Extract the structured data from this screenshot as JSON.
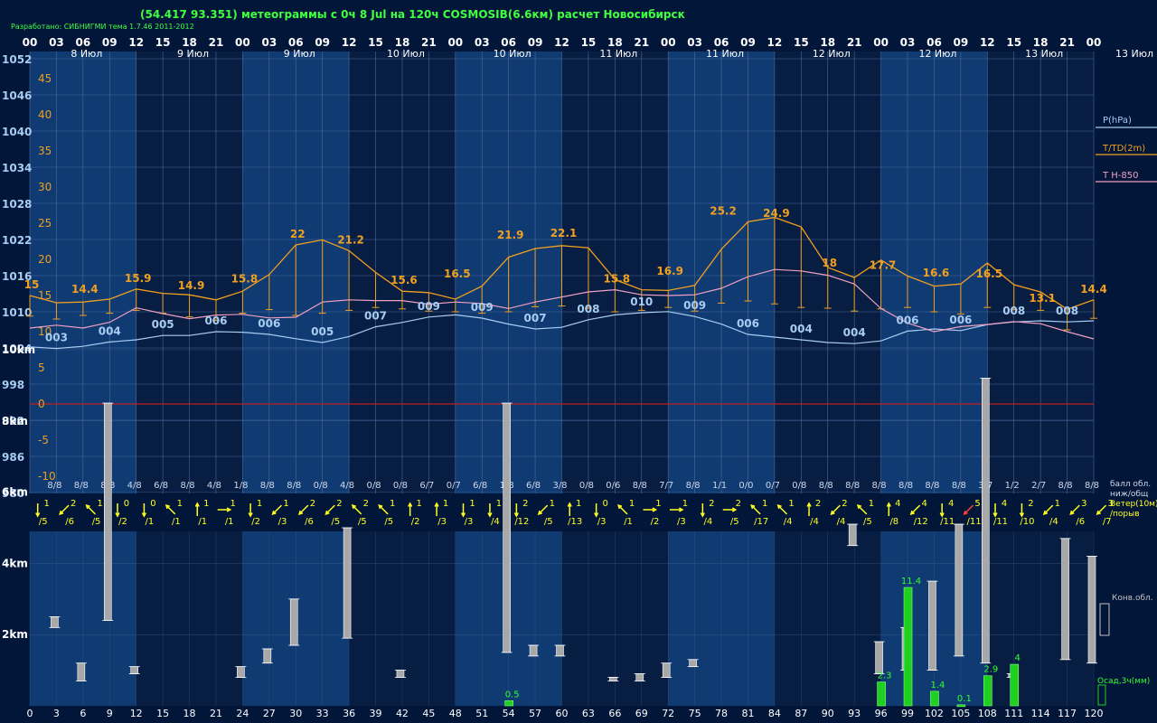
{
  "header": {
    "title": "(54.417 93.351) метеограммы с  0ч 8 Jul на 120ч COSMOSIB(6.6км) расчет Новосибирск",
    "credit": "Разработано: СИБНИГМИ тема 1.7.46 2011-2012"
  },
  "colors": {
    "background": "#02163a",
    "band_light": "#0f3a72",
    "band_dark": "#071d42",
    "grid": "#4d6a99",
    "pressure": "#a9ccf2",
    "temperature": "#f0a020",
    "t850": "#f0a0c0",
    "wind": "#ffff20",
    "wind_strong": "#ff4030",
    "cloud_bar": "#a8a8a8",
    "precip_bar": "#20d020",
    "precip_label": "#30ff30",
    "zero_line": "#c02020"
  },
  "chart_data": {
    "type": "line",
    "hour_ticks": [
      "00",
      "03",
      "06",
      "09",
      "12",
      "15",
      "18",
      "21",
      "00",
      "03",
      "06",
      "09",
      "12",
      "15",
      "18",
      "21",
      "00",
      "03",
      "06",
      "09",
      "12",
      "15",
      "18",
      "21",
      "00",
      "03",
      "06",
      "09",
      "12",
      "15",
      "18",
      "21",
      "00",
      "03",
      "06",
      "09",
      "12",
      "15",
      "18",
      "21",
      "00"
    ],
    "day_labels": [
      "8 Июл",
      "9 Июл",
      "9 Июл",
      "10 Июл",
      "10 Июл",
      "11 Июл",
      "11 Июл",
      "12 Июл",
      "12 Июл",
      "13 Июл",
      "13 Июл"
    ],
    "pressure_axis": {
      "ticks": [
        "1052",
        "1046",
        "1040",
        "1034",
        "1028",
        "1022",
        "1016",
        "1010",
        "1004",
        "998",
        "992",
        "986",
        "980"
      ]
    },
    "temp_axis": {
      "ticks": [
        "45",
        "40",
        "35",
        "30",
        "25",
        "20",
        "15",
        "10",
        "5",
        "0",
        "-5",
        "-10"
      ],
      "ylim": [
        -10,
        45
      ]
    },
    "legend": {
      "pressure": "P(hPa)",
      "temperature": "T/TD(2m)",
      "t850": "T H-850",
      "cloud_cover": "балл обл.\nниж/общ",
      "wind": "Ветер(10м)\n/порыв",
      "convective": "Конв.обл.",
      "precip": "Осад,3ч(мм)"
    },
    "x_hours": [
      0,
      3,
      6,
      9,
      12,
      15,
      18,
      21,
      24,
      27,
      30,
      33,
      36,
      39,
      42,
      45,
      48,
      51,
      54,
      57,
      60,
      63,
      66,
      69,
      72,
      75,
      78,
      81,
      84,
      87,
      90,
      93,
      96,
      99,
      102,
      105,
      108,
      111,
      114,
      117,
      120
    ],
    "pressure_series": [
      1004.7,
      1004.4,
      1004.8,
      1005.6,
      1006.0,
      1006.8,
      1006.8,
      1007.5,
      1007.4,
      1007.0,
      1006.2,
      1005.5,
      1006.6,
      1008.4,
      1009.2,
      1010.2,
      1010.6,
      1010.0,
      1008.9,
      1008.0,
      1008.3,
      1009.7,
      1010.6,
      1011.0,
      1011.2,
      1010.3,
      1008.9,
      1007.0,
      1006.5,
      1006.0,
      1005.5,
      1005.3,
      1005.8,
      1007.6,
      1008.0,
      1007.7,
      1008.8,
      1009.3,
      1009.5,
      1009.3,
      1009.5
    ],
    "pressure_labels": [
      {
        "x": 3,
        "text": "003"
      },
      {
        "x": 9,
        "text": "004"
      },
      {
        "x": 15,
        "text": "005"
      },
      {
        "x": 21,
        "text": "006"
      },
      {
        "x": 27,
        "text": "006"
      },
      {
        "x": 33,
        "text": "005"
      },
      {
        "x": 39,
        "text": "007"
      },
      {
        "x": 45,
        "text": "009"
      },
      {
        "x": 51,
        "text": "009"
      },
      {
        "x": 57,
        "text": "007"
      },
      {
        "x": 63,
        "text": "008"
      },
      {
        "x": 69,
        "text": "010"
      },
      {
        "x": 75,
        "text": "009"
      },
      {
        "x": 81,
        "text": "006"
      },
      {
        "x": 87,
        "text": "004"
      },
      {
        "x": 93,
        "text": "004"
      },
      {
        "x": 99,
        "text": "006"
      },
      {
        "x": 105,
        "text": "006"
      },
      {
        "x": 111,
        "text": "008"
      },
      {
        "x": 117,
        "text": "008"
      }
    ],
    "temp_series": [
      15.0,
      14.0,
      14.1,
      14.5,
      15.9,
      15.3,
      15.1,
      14.4,
      15.6,
      17.9,
      22.0,
      22.7,
      21.2,
      18.2,
      15.6,
      15.4,
      14.5,
      16.3,
      20.3,
      21.5,
      21.9,
      21.6,
      17.2,
      15.8,
      15.7,
      16.4,
      21.4,
      25.2,
      25.8,
      24.5,
      18.9,
      17.5,
      19.9,
      17.7,
      16.3,
      16.6,
      19.5,
      16.5,
      15.5,
      13.1,
      14.4
    ],
    "temp_labels": [
      {
        "x": 0,
        "v": 15.0,
        "text": "15"
      },
      {
        "x": 6,
        "v": 14.4,
        "text": "14.4"
      },
      {
        "x": 12,
        "v": 15.9,
        "text": "15.9"
      },
      {
        "x": 18,
        "v": 14.9,
        "text": "14.9"
      },
      {
        "x": 24,
        "v": 15.8,
        "text": "15.8"
      },
      {
        "x": 30,
        "v": 22.0,
        "text": "22"
      },
      {
        "x": 36,
        "v": 21.2,
        "text": "21.2"
      },
      {
        "x": 42,
        "v": 15.6,
        "text": "15.6"
      },
      {
        "x": 48,
        "v": 16.5,
        "text": "16.5"
      },
      {
        "x": 54,
        "v": 21.9,
        "text": "21.9"
      },
      {
        "x": 60,
        "v": 22.1,
        "text": "22.1"
      },
      {
        "x": 66,
        "v": 15.8,
        "text": "15.8"
      },
      {
        "x": 72,
        "v": 16.9,
        "text": "16.9"
      },
      {
        "x": 78,
        "v": 25.2,
        "text": "25.2"
      },
      {
        "x": 84,
        "v": 24.9,
        "text": "24.9"
      },
      {
        "x": 90,
        "v": 18.0,
        "text": "18"
      },
      {
        "x": 96,
        "v": 17.7,
        "text": "17.7"
      },
      {
        "x": 102,
        "v": 16.6,
        "text": "16.6"
      },
      {
        "x": 108,
        "v": 16.5,
        "text": "16.5"
      },
      {
        "x": 114,
        "v": 13.1,
        "text": "13.1"
      },
      {
        "x": 120,
        "v": 14.4,
        "text": "14.4"
      }
    ],
    "dewpoint_series": [
      13.4,
      13.0,
      13.5,
      13.8,
      14.2,
      13.8,
      13.3,
      12.8,
      13.8,
      14.3,
      13.5,
      13.8,
      14.2,
      14.6,
      14.4,
      14.1,
      14.0,
      13.8,
      14.0,
      14.7,
      14.8,
      14.5,
      14.0,
      14.2,
      14.6,
      14.1,
      15.2,
      15.5,
      15.1,
      14.6,
      14.5,
      14.1,
      14.4,
      14.6,
      14.0,
      13.7,
      14.6,
      14.3,
      14.2,
      11.5,
      13.1
    ],
    "t850_series": [
      10.5,
      10.9,
      10.5,
      11.3,
      13.3,
      12.5,
      11.8,
      12.3,
      12.4,
      11.9,
      12.0,
      14.1,
      14.4,
      14.3,
      14.3,
      13.8,
      14.1,
      13.9,
      13.2,
      14.1,
      14.8,
      15.5,
      15.8,
      15.1,
      15.0,
      15.1,
      16.0,
      17.6,
      18.6,
      18.4,
      17.8,
      16.6,
      13.2,
      11.2,
      10.0,
      10.7,
      11.0,
      11.4,
      11.1,
      10.0,
      9.0
    ],
    "cloud_cover": [
      "8/8",
      "8/8",
      "8/8",
      "8/8",
      "4/8",
      "6/8",
      "8/8",
      "4/8",
      "1/8",
      "8/8",
      "8/8",
      "0/8",
      "4/8",
      "0/8",
      "0/8",
      "6/7",
      "0/7",
      "6/8",
      "1/8",
      "6/8",
      "3/8",
      "0/8",
      "0/6",
      "8/8",
      "7/7",
      "8/8",
      "1/1",
      "0/0",
      "0/7",
      "0/8",
      "8/8",
      "8/8",
      "8/8",
      "8/8",
      "8/8",
      "8/8",
      "3/7",
      "1/2",
      "2/7",
      "8/8",
      "8/8"
    ],
    "wind": [
      {
        "speed": "",
        "gust": ""
      },
      {
        "speed": "1",
        "gust": "/5",
        "dir": "s"
      },
      {
        "speed": "2",
        "gust": "/6",
        "dir": "sw"
      },
      {
        "speed": "1",
        "gust": "/5",
        "dir": "nw"
      },
      {
        "speed": "0",
        "gust": "/2",
        "dir": "s"
      },
      {
        "speed": "0",
        "gust": "/1",
        "dir": "s"
      },
      {
        "speed": "1",
        "gust": "/1",
        "dir": "nw"
      },
      {
        "speed": "1",
        "gust": "/1",
        "dir": "n"
      },
      {
        "speed": "1",
        "gust": "/1",
        "dir": "e"
      },
      {
        "speed": "1",
        "gust": "/2",
        "dir": "s"
      },
      {
        "speed": "1",
        "gust": "/3",
        "dir": "sw"
      },
      {
        "speed": "2",
        "gust": "/6",
        "dir": "sw"
      },
      {
        "speed": "2",
        "gust": "/5",
        "dir": "sw"
      },
      {
        "speed": "2",
        "gust": "/5",
        "dir": "nw"
      },
      {
        "speed": "1",
        "gust": "/5",
        "dir": "nw"
      },
      {
        "speed": "1",
        "gust": "/2",
        "dir": "n"
      },
      {
        "speed": "1",
        "gust": "/3",
        "dir": "n"
      },
      {
        "speed": "1",
        "gust": "/3",
        "dir": "s"
      },
      {
        "speed": "1",
        "gust": "/4",
        "dir": "s"
      },
      {
        "speed": "2",
        "gust": "/12",
        "dir": "s"
      },
      {
        "speed": "1",
        "gust": "/5",
        "dir": "sw"
      },
      {
        "speed": "1",
        "gust": "/13",
        "dir": "n"
      },
      {
        "speed": "0",
        "gust": "/3",
        "dir": "s"
      },
      {
        "speed": "1",
        "gust": "/1",
        "dir": "nw"
      },
      {
        "speed": "1",
        "gust": "/2",
        "dir": "e"
      },
      {
        "speed": "1",
        "gust": "/3",
        "dir": "e"
      },
      {
        "speed": "2",
        "gust": "/4",
        "dir": "s"
      },
      {
        "speed": "2",
        "gust": "/5",
        "dir": "e"
      },
      {
        "speed": "1",
        "gust": "/17",
        "dir": "nw"
      },
      {
        "speed": "1",
        "gust": "/4",
        "dir": "nw"
      },
      {
        "speed": "2",
        "gust": "/4",
        "dir": "n"
      },
      {
        "speed": "2",
        "gust": "/4",
        "dir": "sw"
      },
      {
        "speed": "1",
        "gust": "/5",
        "dir": "nw"
      },
      {
        "speed": "4",
        "gust": "/8",
        "dir": "n"
      },
      {
        "speed": "4",
        "gust": "/12",
        "dir": "sw"
      },
      {
        "speed": "4",
        "gust": "/11",
        "dir": "s"
      },
      {
        "speed": "5",
        "gust": "/11",
        "dir": "sw",
        "strong": true
      },
      {
        "speed": "4",
        "gust": "/11",
        "dir": "s"
      },
      {
        "speed": "2",
        "gust": "/10",
        "dir": "s"
      },
      {
        "speed": "1",
        "gust": "/4",
        "dir": "sw"
      },
      {
        "speed": "3",
        "gust": "/6",
        "dir": "sw"
      },
      {
        "speed": "3",
        "gust": "/7",
        "dir": "sw"
      }
    ],
    "height_axis": {
      "ticks": [
        "10km",
        "8km",
        "6km",
        "4km",
        "2km"
      ],
      "ylim": [
        0,
        10
      ]
    },
    "cloud_bars": [
      {
        "x": 3,
        "bottom": 2.2,
        "top": 2.5
      },
      {
        "x": 6,
        "bottom": 0.7,
        "top": 1.2
      },
      {
        "x": 9,
        "bottom": 2.4,
        "top": 8.5
      },
      {
        "x": 12,
        "bottom": 0.9,
        "top": 1.1
      },
      {
        "x": 24,
        "bottom": 0.8,
        "top": 1.1
      },
      {
        "x": 27,
        "bottom": 1.2,
        "top": 1.6
      },
      {
        "x": 30,
        "bottom": 1.7,
        "top": 3.0
      },
      {
        "x": 36,
        "bottom": 1.9,
        "top": 5.0
      },
      {
        "x": 42,
        "bottom": 0.8,
        "top": 1.0
      },
      {
        "x": 54,
        "bottom": 1.5,
        "top": 8.5
      },
      {
        "x": 57,
        "bottom": 1.4,
        "top": 1.7
      },
      {
        "x": 60,
        "bottom": 1.4,
        "top": 1.7
      },
      {
        "x": 66,
        "bottom": 0.7,
        "top": 0.8
      },
      {
        "x": 69,
        "bottom": 0.7,
        "top": 0.9
      },
      {
        "x": 72,
        "bottom": 0.8,
        "top": 1.2
      },
      {
        "x": 75,
        "bottom": 1.1,
        "top": 1.3
      },
      {
        "x": 93,
        "bottom": 4.5,
        "top": 5.1
      },
      {
        "x": 96,
        "bottom": 0.9,
        "top": 1.8
      },
      {
        "x": 99,
        "bottom": 1.0,
        "top": 2.2
      },
      {
        "x": 102,
        "bottom": 1.0,
        "top": 3.5
      },
      {
        "x": 105,
        "bottom": 1.4,
        "top": 5.1
      },
      {
        "x": 108,
        "bottom": 1.2,
        "top": 9.2
      },
      {
        "x": 111,
        "bottom": 0.8,
        "top": 0.9
      },
      {
        "x": 117,
        "bottom": 1.3,
        "top": 4.7
      },
      {
        "x": 120,
        "bottom": 1.2,
        "top": 4.2
      }
    ],
    "precip": [
      {
        "x": 54,
        "value": 0.5,
        "label": "0.5"
      },
      {
        "x": 96,
        "value": 2.3,
        "label": "2.3"
      },
      {
        "x": 99,
        "value": 11.4,
        "label": "11.4"
      },
      {
        "x": 102,
        "value": 1.4,
        "label": "1.4"
      },
      {
        "x": 105,
        "value": 0.1,
        "label": "0.1"
      },
      {
        "x": 108,
        "value": 2.9,
        "label": "2.9"
      },
      {
        "x": 111,
        "value": 4.0,
        "label": "4"
      }
    ],
    "precip_axis_max": 11.4,
    "bottom_hours": [
      "0",
      "3",
      "6",
      "9",
      "12",
      "15",
      "18",
      "21",
      "24",
      "27",
      "30",
      "33",
      "36",
      "39",
      "42",
      "45",
      "48",
      "51",
      "54",
      "57",
      "60",
      "63",
      "66",
      "69",
      "72",
      "75",
      "78",
      "81",
      "84",
      "87",
      "90",
      "93",
      "96",
      "99",
      "102",
      "105",
      "108",
      "111",
      "114",
      "117",
      "120"
    ]
  }
}
